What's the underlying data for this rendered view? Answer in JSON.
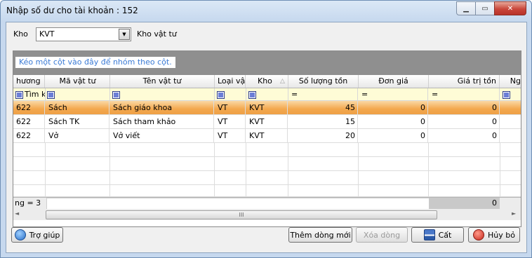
{
  "window": {
    "title": "Nhập số dư cho tài khoản : 152",
    "close_glyph": "✕",
    "max_glyph": "▭",
    "min_glyph": "▁"
  },
  "toolbar": {
    "kho_label": "Kho",
    "kho_value": "KVT",
    "kho_desc": "Kho vật tư"
  },
  "grid": {
    "group_hint": "Kéo một cột vào đây để nhóm theo cột.",
    "columns": [
      "hương",
      "Mã vật tư",
      "Tên vật tư",
      "Loại vật",
      "Kho",
      "Số lượng tồn",
      "Đơn giá",
      "Giá trị tồn",
      "Ng"
    ],
    "sort_indicator": "△",
    "filter_row": {
      "first": "Tìm kiếm",
      "eq": "="
    },
    "rows": [
      {
        "c0": "622",
        "ma": "Sách",
        "ten": "Sách giáo khoa",
        "loai": "VT",
        "kho": "KVT",
        "sl": "45",
        "dg": "0",
        "gt": "0"
      },
      {
        "c0": "622",
        "ma": "Sách TK",
        "ten": "Sách tham khảo",
        "loai": "VT",
        "kho": "KVT",
        "sl": "15",
        "dg": "0",
        "gt": "0"
      },
      {
        "c0": "622",
        "ma": "Vở",
        "ten": "Vở viết",
        "loai": "VT",
        "kho": "KVT",
        "sl": "20",
        "dg": "0",
        "gt": "0"
      }
    ],
    "footer_count": "ng = 3",
    "footer_total": "0",
    "scroll_grip": "III",
    "scroll_left": "◄",
    "scroll_right": "►"
  },
  "buttons": {
    "help": "Trợ giúp",
    "add_row": "Thêm dòng mới",
    "delete_row": "Xóa dòng",
    "save": "Cất",
    "cancel": "Hủy bỏ"
  }
}
